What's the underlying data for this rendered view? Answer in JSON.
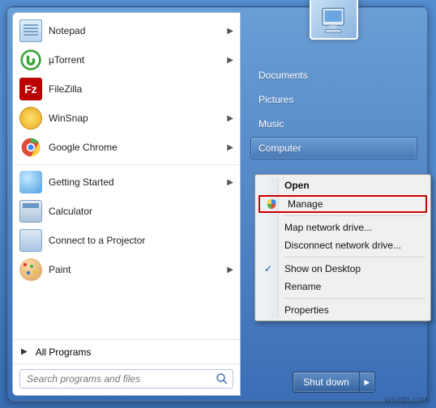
{
  "left": {
    "programs": [
      {
        "label": "Notepad",
        "arrow": true,
        "icon": "notepad-icon"
      },
      {
        "label": "µTorrent",
        "arrow": true,
        "icon": "utorrent-icon"
      },
      {
        "label": "FileZilla",
        "arrow": false,
        "icon": "filezilla-icon"
      },
      {
        "label": "WinSnap",
        "arrow": true,
        "icon": "winsnap-icon"
      },
      {
        "label": "Google Chrome",
        "arrow": true,
        "icon": "chrome-icon"
      },
      {
        "label": "Getting Started",
        "arrow": true,
        "icon": "getting-started-icon"
      },
      {
        "label": "Calculator",
        "arrow": false,
        "icon": "calculator-icon"
      },
      {
        "label": "Connect to a Projector",
        "arrow": false,
        "icon": "projector-icon"
      },
      {
        "label": "Paint",
        "arrow": true,
        "icon": "paint-icon"
      }
    ],
    "all_programs": "All Programs",
    "search_placeholder": "Search programs and files"
  },
  "right": {
    "items": [
      {
        "label": "Documents",
        "highlighted": false
      },
      {
        "label": "Pictures",
        "highlighted": false
      },
      {
        "label": "Music",
        "highlighted": false
      },
      {
        "label": "Computer",
        "highlighted": true
      }
    ],
    "shutdown": "Shut down"
  },
  "context_menu": {
    "items": [
      {
        "label": "Open",
        "bold": true
      },
      {
        "label": "Manage",
        "shield": true,
        "red_box": true
      },
      {
        "sep": true
      },
      {
        "label": "Map network drive..."
      },
      {
        "label": "Disconnect network drive..."
      },
      {
        "sep": true
      },
      {
        "label": "Show on Desktop",
        "checked": true
      },
      {
        "label": "Rename"
      },
      {
        "sep": true
      },
      {
        "label": "Properties"
      }
    ]
  },
  "watermark": "wsxdn.com"
}
